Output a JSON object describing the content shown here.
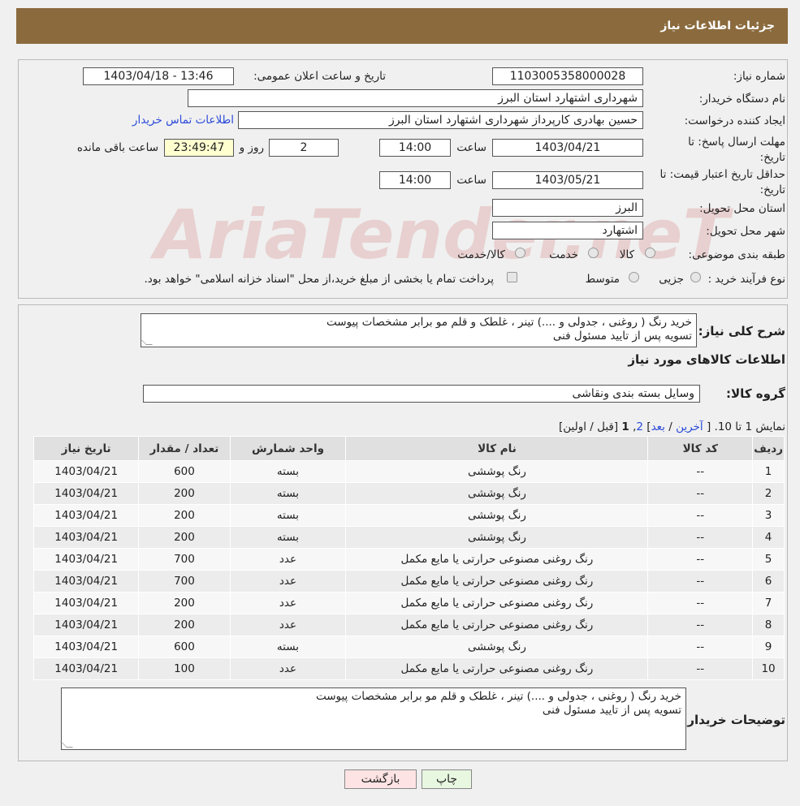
{
  "header": {
    "title": "جزئیات اطلاعات نیاز"
  },
  "info": {
    "need_number_label": "شماره نیاز:",
    "need_number": "1103005358000028",
    "announce_label": "تاریخ و ساعت اعلان عمومی:",
    "announce_value": "1403/04/18 - 13:46",
    "buyer_org_label": "نام دستگاه خریدار:",
    "buyer_org": "شهرداری اشتهارد استان البرز",
    "requester_label": "ایجاد کننده درخواست:",
    "requester": "حسین بهادری کارپرداز شهرداری اشتهارد استان البرز",
    "contact_link": "اطلاعات تماس خریدار",
    "deadline_label": "مهلت ارسال پاسخ: تا تاریخ:",
    "deadline_date": "1403/04/21",
    "time_label": "ساعت",
    "deadline_time": "14:00",
    "days": "2",
    "days_label": "روز و",
    "remaining": "23:49:47",
    "remaining_label": "ساعت باقی مانده",
    "validity_label": "حداقل تاریخ اعتبار قیمت: تا تاریخ:",
    "validity_date": "1403/05/21",
    "validity_time": "14:00",
    "province_label": "استان محل تحویل:",
    "province": "البرز",
    "city_label": "شهر محل تحویل:",
    "city": "اشتهارد",
    "category_label": "طبقه بندی موضوعی:",
    "category_options": [
      "کالا",
      "خدمت",
      "کالا/خدمت"
    ],
    "process_label": "نوع فرآیند خرید :",
    "process_options": [
      "جزیی",
      "متوسط"
    ],
    "process_note": "پرداخت تمام یا بخشی از مبلغ خرید،از محل \"اسناد خزانه اسلامی\" خواهد بود."
  },
  "watermark": "AriaTender.neT",
  "details": {
    "summary_label": "شرح کلی نیاز:",
    "summary_text": "خرید رنگ ( روغنی ، جدولی و ....) تینر ، غلطک و قلم مو برابر مشخصات پیوست\nتسویه پس از تایید مسئول فنی",
    "goods_info_title": "اطلاعات کالاهای مورد نیاز",
    "group_label": "گروه کالا:",
    "group_value": "وسایل بسته بندی  ونقاشی",
    "pager_prefix": "نمایش 1 تا 10. [",
    "pager_last": "آخرین",
    "pager_next": "بعد",
    "pager_page2": "2",
    "pager_page1": "1",
    "pager_suffix": "[قبل / اولین]",
    "buyer_notes_label": "توضیحات خریدار:",
    "buyer_notes_text": "خرید رنگ ( روغنی ، جدولی و ....) تینر ، غلطک و قلم مو برابر مشخصات پیوست\nتسویه پس از تایید مسئول فنی"
  },
  "table": {
    "headers": [
      "ردیف",
      "کد کالا",
      "نام کالا",
      "واحد شمارش",
      "تعداد / مقدار",
      "تاریخ نیاز"
    ],
    "rows": [
      [
        "1",
        "--",
        "رنگ پوششی",
        "بسته",
        "600",
        "1403/04/21"
      ],
      [
        "2",
        "--",
        "رنگ پوششی",
        "بسته",
        "200",
        "1403/04/21"
      ],
      [
        "3",
        "--",
        "رنگ پوششی",
        "بسته",
        "200",
        "1403/04/21"
      ],
      [
        "4",
        "--",
        "رنگ پوششی",
        "بسته",
        "200",
        "1403/04/21"
      ],
      [
        "5",
        "--",
        "رنگ روغنی مصنوعی حرارتی یا مایع مکمل",
        "عدد",
        "700",
        "1403/04/21"
      ],
      [
        "6",
        "--",
        "رنگ روغنی مصنوعی حرارتی یا مایع مکمل",
        "عدد",
        "700",
        "1403/04/21"
      ],
      [
        "7",
        "--",
        "رنگ روغنی مصنوعی حرارتی یا مایع مکمل",
        "عدد",
        "200",
        "1403/04/21"
      ],
      [
        "8",
        "--",
        "رنگ روغنی مصنوعی حرارتی یا مایع مکمل",
        "عدد",
        "200",
        "1403/04/21"
      ],
      [
        "9",
        "--",
        "رنگ پوششی",
        "بسته",
        "600",
        "1403/04/21"
      ],
      [
        "10",
        "--",
        "رنگ روغنی مصنوعی حرارتی یا مایع مکمل",
        "عدد",
        "100",
        "1403/04/21"
      ]
    ]
  },
  "buttons": {
    "print": "چاپ",
    "back": "بازگشت"
  }
}
